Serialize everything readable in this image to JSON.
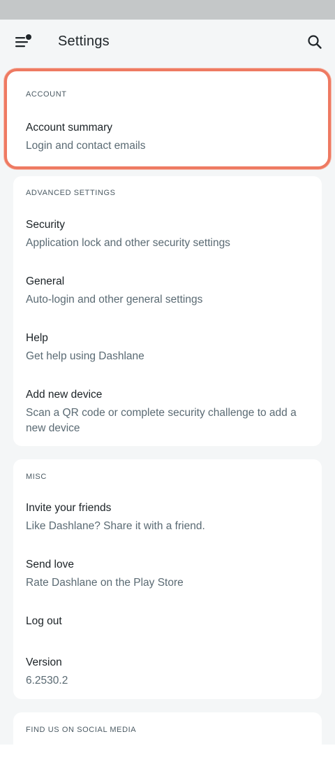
{
  "app_bar": {
    "title": "Settings",
    "menu_icon": "menu-with-dot-icon",
    "search_icon": "search-icon"
  },
  "sections": {
    "account": {
      "header": "ACCOUNT",
      "items": [
        {
          "title": "Account summary",
          "subtitle": "Login and contact emails"
        }
      ]
    },
    "advanced": {
      "header": "ADVANCED SETTINGS",
      "items": [
        {
          "title": "Security",
          "subtitle": "Application lock and other security settings"
        },
        {
          "title": "General",
          "subtitle": "Auto-login and other general settings"
        },
        {
          "title": "Help",
          "subtitle": "Get help using Dashlane"
        },
        {
          "title": "Add new device",
          "subtitle_line1": "Scan a QR code or complete security challenge to add a",
          "subtitle_line2": "new device"
        }
      ]
    },
    "misc": {
      "header": "MISC",
      "items": [
        {
          "title": "Invite your friends",
          "subtitle": "Like Dashlane? Share it with a friend."
        },
        {
          "title": "Send love",
          "subtitle": "Rate Dashlane on the Play Store"
        },
        {
          "title": "Log out"
        },
        {
          "title": "Version",
          "subtitle": "6.2530.2"
        }
      ]
    },
    "social": {
      "header": "FIND US ON SOCIAL MEDIA"
    }
  },
  "colors": {
    "highlight_border": "#ee7a62",
    "background": "#f4f6f7",
    "card": "#ffffff",
    "status_bar": "#c4c7c8"
  }
}
